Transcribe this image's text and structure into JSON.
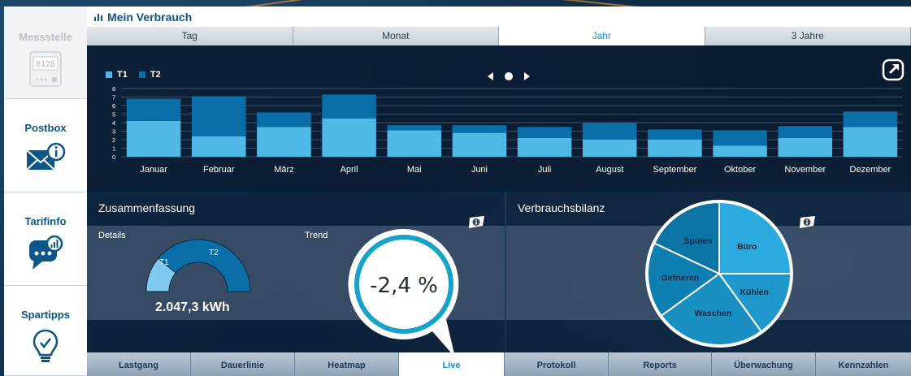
{
  "sidebar": {
    "items": [
      {
        "label": "Messstelle",
        "icon": "meter-icon",
        "disabled": true,
        "meter_digits": "0128"
      },
      {
        "label": "Postbox",
        "icon": "mail-info-icon"
      },
      {
        "label": "Tarifinfo",
        "icon": "chat-chart-icon"
      },
      {
        "label": "Spartipps",
        "icon": "lightbulb-check-icon"
      }
    ]
  },
  "header": {
    "title": "Mein Verbrauch",
    "title_icon": "bar-chart-icon"
  },
  "tabs": [
    {
      "label": "Tag"
    },
    {
      "label": "Monat"
    },
    {
      "label": "Jahr",
      "active": true
    },
    {
      "label": "3 Jahre"
    }
  ],
  "chart_data": {
    "type": "bar",
    "stacked": true,
    "categories": [
      "Januar",
      "Februar",
      "März",
      "April",
      "Mai",
      "Juni",
      "Juli",
      "August",
      "September",
      "Oktober",
      "November",
      "Dezember"
    ],
    "series": [
      {
        "name": "T1",
        "color": "#4fb8e6",
        "values": [
          4.2,
          2.4,
          3.5,
          4.5,
          3.1,
          2.8,
          2.2,
          2.0,
          2.0,
          1.3,
          2.2,
          3.5
        ]
      },
      {
        "name": "T2",
        "color": "#0a6fa8",
        "values": [
          2.6,
          4.7,
          1.7,
          2.8,
          0.6,
          0.9,
          1.3,
          2.0,
          1.2,
          1.8,
          1.4,
          1.8
        ]
      }
    ],
    "ylim": [
      0,
      8
    ],
    "yticks": [
      "0",
      "1",
      "2",
      "3",
      "4",
      "5",
      "6",
      "7",
      "8"
    ],
    "grid": true,
    "legend": "top-left"
  },
  "summary": {
    "title": "Zusammenfassung",
    "details_label": "Details",
    "trend_label": "Trend",
    "gauge": {
      "t1_label": "T1",
      "t2_label": "T2",
      "t1_share": 0.22,
      "total": "2.047,3 kWh"
    },
    "trend_value": "-2,4 %"
  },
  "balance": {
    "title": "Verbrauchsbilanz",
    "chart_data": {
      "type": "pie",
      "slices": [
        {
          "label": "Büro",
          "value": 0.25
        },
        {
          "label": "Kühlen",
          "value": 0.15
        },
        {
          "label": "Waschen",
          "value": 0.25
        },
        {
          "label": "Gefrieren",
          "value": 0.17
        },
        {
          "label": "Spülen",
          "value": 0.18
        }
      ]
    }
  },
  "bottom_tabs": [
    {
      "label": "Lastgang"
    },
    {
      "label": "Dauerlinie"
    },
    {
      "label": "Heatmap"
    },
    {
      "label": "Live",
      "active": true
    },
    {
      "label": "Protokoll"
    },
    {
      "label": "Reports"
    },
    {
      "label": "Überwachung"
    },
    {
      "label": "Kennzahlen"
    }
  ],
  "colors": {
    "brand": "#0b5588",
    "accent": "#1a8fd4",
    "t1": "#4fb8e6",
    "t2": "#0a6fa8"
  }
}
